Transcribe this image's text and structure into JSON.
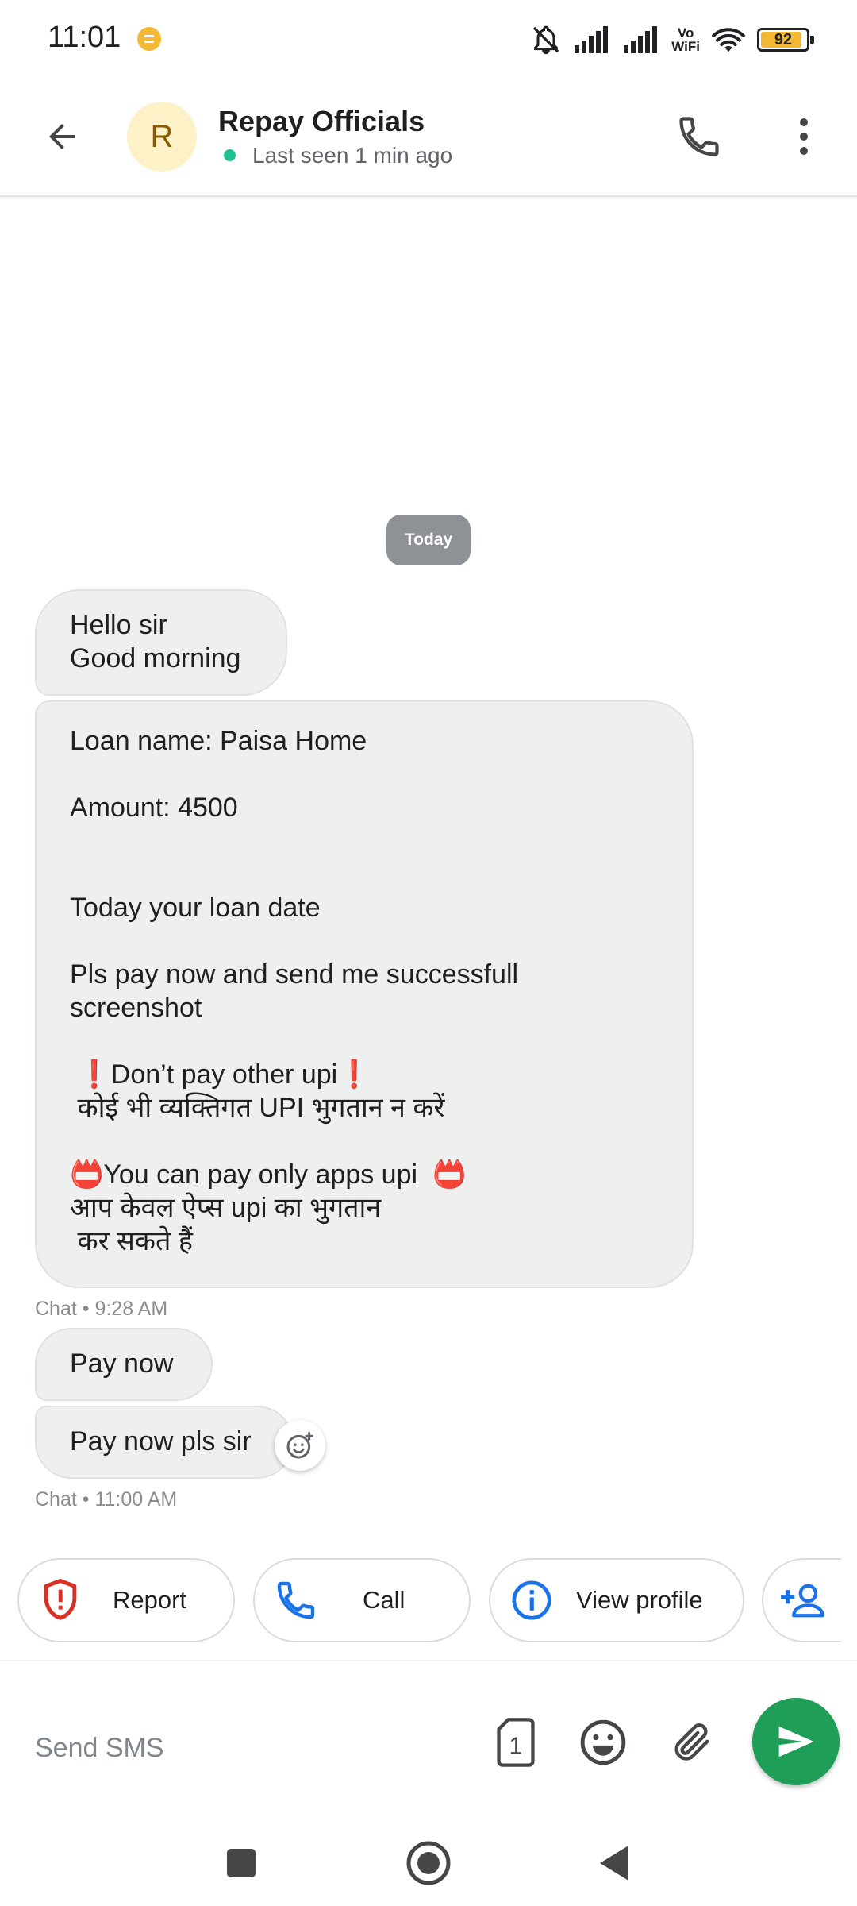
{
  "status_bar": {
    "time": "11:01",
    "battery_level": "92",
    "vowifi_top": "Vo",
    "vowifi_bottom": "WiFi",
    "icons": [
      "notifications-off-icon",
      "signal-icon",
      "signal-icon",
      "vowifi-icon",
      "wifi-icon",
      "battery-icon"
    ]
  },
  "header": {
    "avatar_letter": "R",
    "contact_name": "Repay Officials",
    "last_seen": "Last seen 1 min ago"
  },
  "conversation": {
    "date_label": "Today",
    "messages": [
      {
        "text": "Hello sir\nGood morning"
      },
      {
        "text": "Loan name: Paisa Home\n\nAmount: 4500\n\n\nToday your loan date\n\nPls pay now and send me successfull\nscreenshot\n\n ❗Don’t pay other upi❗\n कोई भी व्यक्तिगत UPI भुगतान न करें\n\n📛You can pay only apps upi  📛\nआप केवल ऐप्स upi का भुगतान\n कर सकते हैं"
      },
      {
        "text": "Pay now"
      },
      {
        "text": "Pay now pls sir"
      }
    ],
    "meta_1": "Chat • 9:28 AM",
    "meta_2": "Chat • 11:00 AM"
  },
  "actions": {
    "report": "Report",
    "call": "Call",
    "view_profile": "View profile"
  },
  "compose": {
    "placeholder": "Send SMS",
    "sim_number": "1"
  },
  "colors": {
    "accent_blue": "#1a73e8",
    "send_green": "#1e9e57",
    "report_red": "#d93025",
    "avatar_bg": "#fdf1c8",
    "bubble_bg": "#eef0f0",
    "online_green": "#1fbf8f"
  }
}
